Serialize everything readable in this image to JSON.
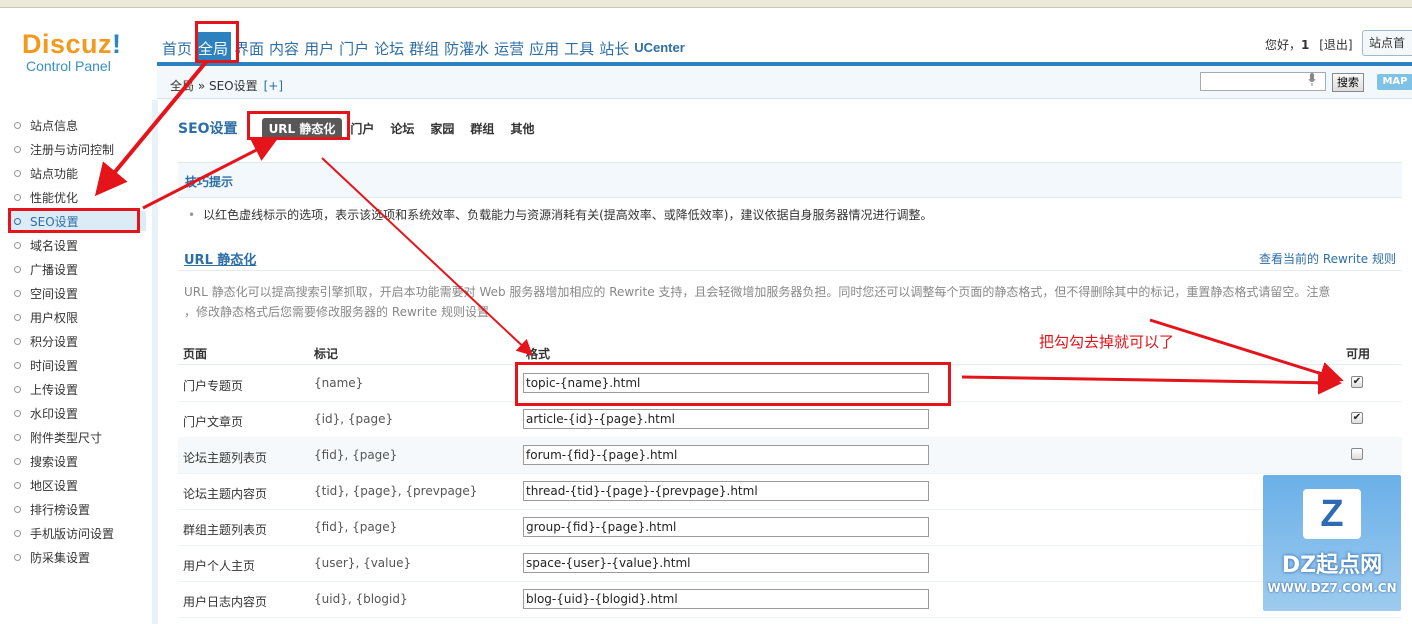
{
  "header": {
    "logo_main": "Discuz",
    "logo_exclaim": "!",
    "logo_sub": "Control Panel",
    "nav": [
      "首页",
      "全局",
      "界面",
      "内容",
      "用户",
      "门户",
      "论坛",
      "群组",
      "防灌水",
      "运营",
      "应用",
      "工具",
      "站长",
      "UCenter"
    ],
    "active_nav": "全局",
    "greeting": "您好，",
    "user": "1",
    "logout": "[退出]",
    "site_button": "站点首"
  },
  "breadcrumb": {
    "path": "全局 » SEO设置",
    "plus": "[+]",
    "search_button": "搜索",
    "map_button": "MAP"
  },
  "sidebar": {
    "items": [
      "站点信息",
      "注册与访问控制",
      "站点功能",
      "性能优化",
      "SEO设置",
      "域名设置",
      "广播设置",
      "空间设置",
      "用户权限",
      "积分设置",
      "时间设置",
      "上传设置",
      "水印设置",
      "附件类型尺寸",
      "搜索设置",
      "地区设置",
      "排行榜设置",
      "手机版访问设置",
      "防采集设置"
    ],
    "active": "SEO设置"
  },
  "main": {
    "section_title": "SEO设置",
    "tabs": [
      "URL 静态化",
      "门户",
      "论坛",
      "家园",
      "群组",
      "其他"
    ],
    "active_tab": "URL 静态化",
    "tip_title": "技巧提示",
    "tip_text": "以红色虚线标示的选项，表示该选项和系统效率、负载能力与资源消耗有关(提高效率、或降低效率)，建议依据自身服务器情况进行调整。",
    "url_title": "URL 静态化",
    "rewrite_link": "查看当前的 Rewrite 规则",
    "desc_line1": "URL 静态化可以提高搜索引擎抓取，开启本功能需要对 Web 服务器增加相应的 Rewrite 支持，且会轻微增加服务器负担。同时您还可以调整每个页面的静态格式，但不得删除其中的标记，重置静态格式请留空。注意",
    "desc_line2": "，修改静态格式后您需要修改服务器的 Rewrite 规则设置",
    "col_page": "页面",
    "col_tag": "标记",
    "col_format": "格式",
    "col_enable": "可用",
    "rows": [
      {
        "page": "门户专题页",
        "tags": "{name}",
        "format": "topic-{name}.html",
        "checked": "✔"
      },
      {
        "page": "门户文章页",
        "tags": "{id}, {page}",
        "format": "article-{id}-{page}.html",
        "checked": "✔"
      },
      {
        "page": "论坛主题列表页",
        "tags": "{fid}, {page}",
        "format": "forum-{fid}-{page}.html",
        "checked": ""
      },
      {
        "page": "论坛主题内容页",
        "tags": "{tid}, {page}, {prevpage}",
        "format": "thread-{tid}-{page}-{prevpage}.html",
        "checked": ""
      },
      {
        "page": "群组主题列表页",
        "tags": "{fid}, {page}",
        "format": "group-{fid}-{page}.html",
        "checked": ""
      },
      {
        "page": "用户个人主页",
        "tags": "{user}, {value}",
        "format": "space-{user}-{value}.html",
        "checked": ""
      },
      {
        "page": "用户日志内容页",
        "tags": "{uid}, {blogid}",
        "format": "blog-{uid}-{blogid}.html",
        "checked": ""
      }
    ]
  },
  "annotation": {
    "text": "把勾勾去掉就可以了",
    "color": "#e5141b"
  },
  "watermark": {
    "logo": "Z",
    "name": "DZ起点网",
    "url": "WWW.DZ7.COM.CN"
  }
}
